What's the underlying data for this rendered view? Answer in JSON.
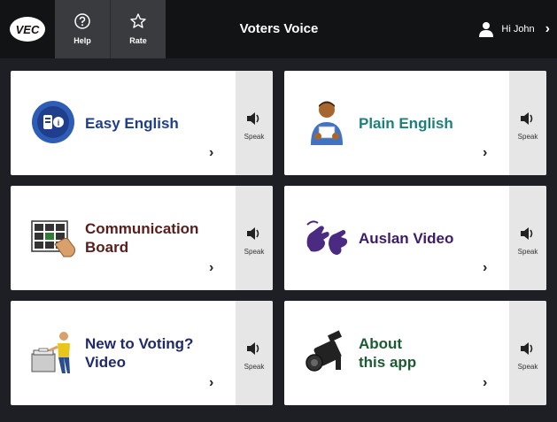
{
  "header": {
    "logo_text": "VEC",
    "help_label": "Help",
    "rate_label": "Rate",
    "title": "Voters Voice",
    "user_greeting": "Hi John",
    "chevron": "›"
  },
  "tiles": [
    {
      "label": "Easy English",
      "speak_label": "Speak",
      "icon": "easy-english-icon",
      "color": "#1f3e8c"
    },
    {
      "label": "Plain English",
      "speak_label": "Speak",
      "icon": "person-reading-icon",
      "color": "#1e7f7a"
    },
    {
      "label": "Communication\nBoard",
      "speak_label": "Speak",
      "icon": "communication-board-icon",
      "color": "#5a1d1a"
    },
    {
      "label": "Auslan Video",
      "speak_label": "Speak",
      "icon": "sign-language-icon",
      "color": "#3d1b6b"
    },
    {
      "label": "New to Voting?\nVideo",
      "speak_label": "Speak",
      "icon": "voter-at-ballot-box-icon",
      "color": "#1f2a6b"
    },
    {
      "label": "About\nthis app",
      "speak_label": "Speak",
      "icon": "video-camera-icon",
      "color": "#1c5a32"
    }
  ],
  "colors": {
    "topbar": "#121315",
    "background": "#1d1f24",
    "tile": "#ffffff",
    "speak_panel": "#e6e6e6"
  }
}
